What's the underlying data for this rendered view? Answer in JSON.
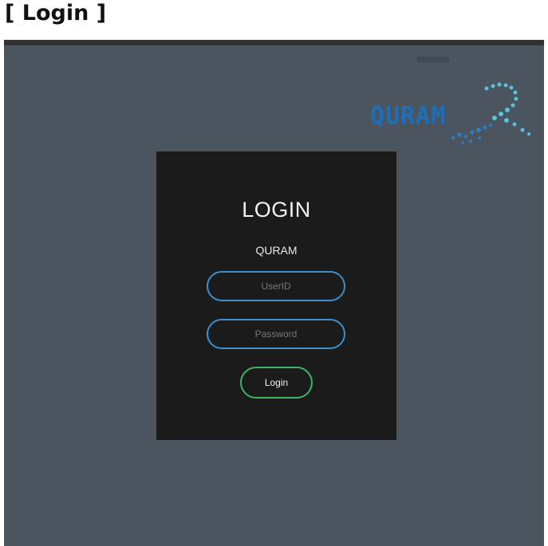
{
  "document": {
    "heading": "[ Login ]"
  },
  "logo": {
    "text": "QURAM",
    "color": "#1f6fb8",
    "accent": "#5bc0de",
    "icon": "quram-logo-icon"
  },
  "login": {
    "title": "LOGIN",
    "subtitle": "QURAM",
    "userid_placeholder": "UserID",
    "password_placeholder": "Password",
    "button_label": "Login",
    "input_border_color": "#3c8fd0",
    "button_border_color": "#3fb55f"
  }
}
